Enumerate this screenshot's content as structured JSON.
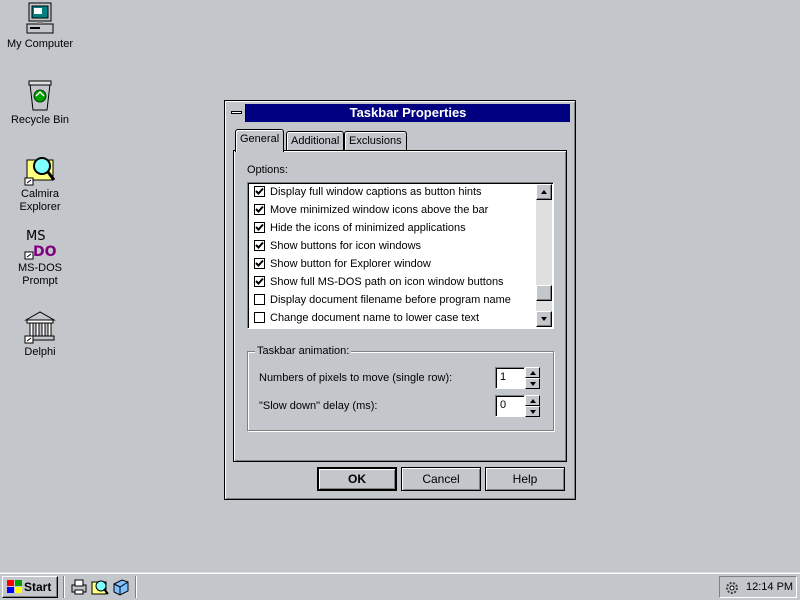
{
  "desktop": {
    "icons": [
      {
        "label": "My Computer",
        "icon": "computer-icon"
      },
      {
        "label": "Recycle Bin",
        "icon": "recycle-bin-icon"
      },
      {
        "label": "Calmira\nExplorer",
        "icon": "magnifier-folder-icon"
      },
      {
        "label": "MS-DOS\nPrompt",
        "icon": "ms-dos-icon"
      },
      {
        "label": "Delphi",
        "icon": "temple-icon"
      }
    ]
  },
  "dialog": {
    "title": "Taskbar Properties",
    "tabs": [
      "General",
      "Additional",
      "Exclusions"
    ],
    "active_tab": "General",
    "options_label": "Options:",
    "options": [
      {
        "label": "Display full window captions as button hints",
        "checked": true
      },
      {
        "label": "Move minimized window icons above the bar",
        "checked": true
      },
      {
        "label": "Hide the icons of minimized applications",
        "checked": true
      },
      {
        "label": "Show buttons for icon windows",
        "checked": true
      },
      {
        "label": "Show button for Explorer window",
        "checked": true
      },
      {
        "label": "Show full MS-DOS path on icon window buttons",
        "checked": true
      },
      {
        "label": "Display document filename before program name",
        "checked": false
      },
      {
        "label": "Change document name to lower case text",
        "checked": false
      }
    ],
    "animation": {
      "group_label": "Taskbar animation:",
      "pixels_label": "Numbers of pixels to move (single row):",
      "pixels_value": "1",
      "delay_label": "\"Slow down\" delay (ms):",
      "delay_value": "0"
    },
    "buttons": {
      "ok": "OK",
      "cancel": "Cancel",
      "help": "Help"
    }
  },
  "taskbar": {
    "start_label": "Start",
    "clock": "12:14 PM"
  }
}
